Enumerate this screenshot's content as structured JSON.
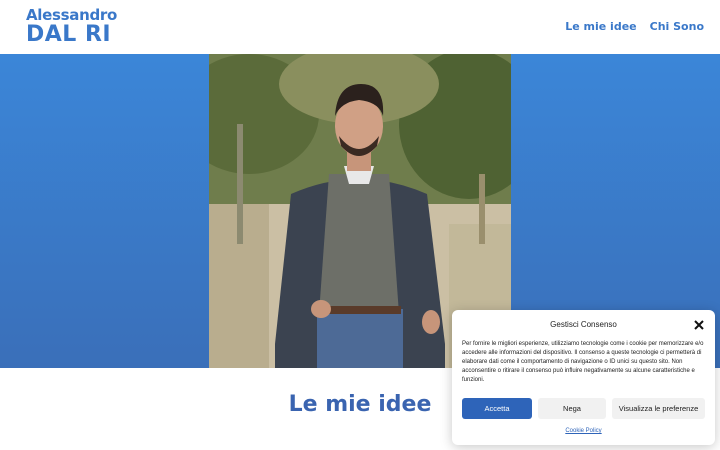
{
  "logo": {
    "line1": "Alessandro",
    "line2": "DAL RI"
  },
  "nav": {
    "items": [
      {
        "label": "Le mie idee"
      },
      {
        "label": "Chi Sono"
      }
    ]
  },
  "hero": {
    "photo_icon": "portrait-photo"
  },
  "section": {
    "title": "Le mie idee"
  },
  "consent": {
    "title": "Gestisci Consenso",
    "text": "Per fornire le migliori esperienze, utilizziamo tecnologie come i cookie per memorizzare e/o accedere alle informazioni del dispositivo. Il consenso a queste tecnologie ci permetterà di elaborare dati come il comportamento di navigazione o ID unici su questo sito. Non acconsentire o ritirare il consenso può influire negativamente su alcune caratteristiche e funzioni.",
    "accept_label": "Accetta",
    "deny_label": "Nega",
    "prefs_label": "Visualizza le preferenze",
    "policy_link": "Cookie Policy"
  },
  "colors": {
    "brand": "#3a78c9",
    "hero_top": "#3b86d8",
    "hero_bottom": "#3a6fb9",
    "accept": "#2e64b9"
  }
}
